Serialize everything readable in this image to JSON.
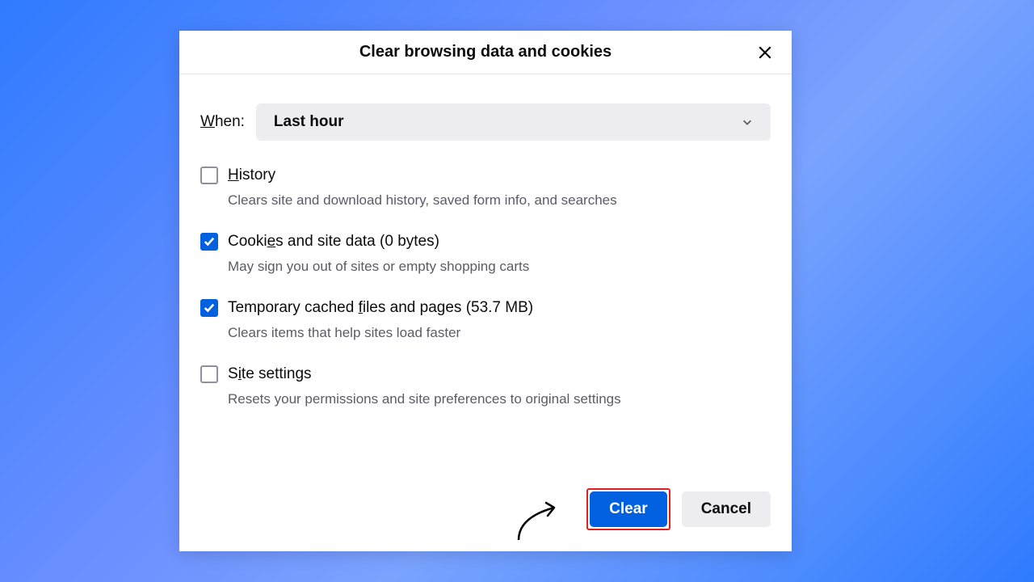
{
  "dialog": {
    "title": "Clear browsing data and cookies",
    "when_label_pre": "W",
    "when_label_post": "hen:",
    "time_range_value": "Last hour",
    "options": [
      {
        "pre": "",
        "u": "H",
        "post": "istory",
        "detail": "",
        "desc": "Clears site and download history, saved form info, and searches",
        "checked": false
      },
      {
        "pre": "Cooki",
        "u": "e",
        "post": "s and site data ",
        "detail": "(0 bytes)",
        "desc": "May sign you out of sites or empty shopping carts",
        "checked": true
      },
      {
        "pre": "Temporary cached ",
        "u": "f",
        "post": "iles and pages ",
        "detail": "(53.7 MB)",
        "desc": "Clears items that help sites load faster",
        "checked": true
      },
      {
        "pre": "S",
        "u": "i",
        "post": "te settings",
        "detail": "",
        "desc": "Resets your permissions and site preferences to original settings",
        "checked": false
      }
    ],
    "clear_label": "Clear",
    "cancel_label": "Cancel"
  }
}
